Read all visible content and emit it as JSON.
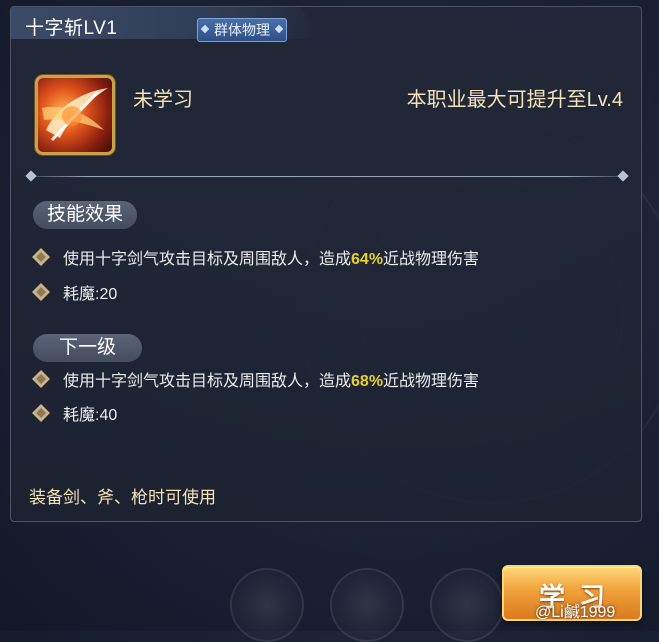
{
  "skill": {
    "name": "十字斩LV1",
    "type_badge": "群体物理",
    "learn_status": "未学习",
    "max_level_text": "本职业最大可提升至Lv.4"
  },
  "current_effect": {
    "section_label": "技能效果",
    "damage_prefix": "使用十字剑气攻击目标及周围敌人，造成",
    "damage_percent": "64%",
    "damage_suffix": "近战物理伤害",
    "mp_cost": "耗魔:20"
  },
  "next_level": {
    "section_label": "下一级",
    "damage_prefix": "使用十字剑气攻击目标及周围敌人，造成",
    "damage_percent": "68%",
    "damage_suffix": "近战物理伤害",
    "mp_cost": "耗魔:40"
  },
  "weapon_requirement": "装备剑、斧、枪时可使用",
  "learn_button_label": "学习",
  "watermark": "@Li鹹1999",
  "colors": {
    "highlight": "#e8d02a",
    "gold_text": "#f2e3b8",
    "badge_blue": "#2d4f86",
    "button_orange": "#f0a13a"
  },
  "icons": {
    "skill_icon": "cross-slash-skill-icon",
    "bullet": "diamond-bullet-icon"
  }
}
